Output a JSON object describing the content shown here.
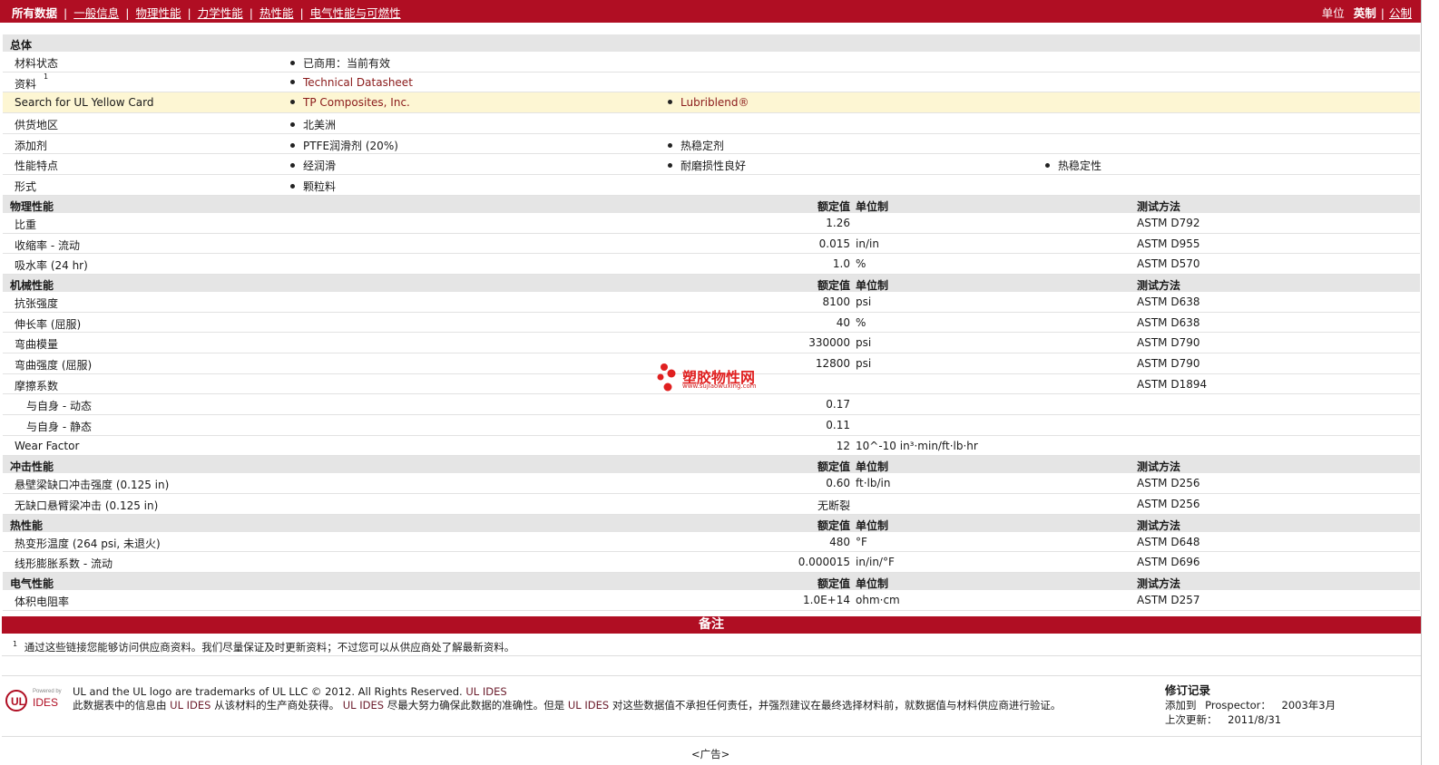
{
  "topnav": {
    "items": [
      "所有数据",
      "一般信息",
      "物理性能",
      "力学性能",
      "热性能",
      "电气性能与可燃性"
    ],
    "sep": "|",
    "units_label": "单位",
    "units_selected": "英制",
    "units_other": "公制"
  },
  "general": {
    "title": "总体",
    "rows": [
      {
        "label": "材料状态",
        "values": [
          "已商用：当前有效"
        ]
      },
      {
        "label": "资料",
        "sup": "1",
        "values": [
          "Technical Datasheet"
        ]
      },
      {
        "label": "Search for UL Yellow Card",
        "values": [
          "TP Composites, Inc.",
          "Lubriblend®"
        ]
      },
      {
        "label": "供货地区",
        "values": [
          "北美洲"
        ]
      },
      {
        "label": "添加剂",
        "values": [
          "PTFE润滑剂 (20%)",
          "热稳定剂"
        ]
      },
      {
        "label": "性能特点",
        "values": [
          "经润滑",
          "耐磨损性良好",
          "热稳定性"
        ]
      },
      {
        "label": "形式",
        "values": [
          "颗粒料"
        ]
      }
    ]
  },
  "headers": {
    "value": "额定值",
    "unit": "单位制",
    "method": "测试方法"
  },
  "sections": [
    {
      "title": "物理性能",
      "rows": [
        {
          "label": "比重",
          "value": "1.26",
          "unit": "",
          "method": "ASTM D792"
        },
        {
          "label": "收缩率  - 流动",
          "value": "0.015",
          "unit": "in/in",
          "method": "ASTM D955"
        },
        {
          "label": "吸水率 (24 hr)",
          "value": "1.0",
          "unit": "%",
          "method": "ASTM D570"
        }
      ]
    },
    {
      "title": "机械性能",
      "rows": [
        {
          "label": "抗张强度",
          "value": "8100",
          "unit": "psi",
          "method": "ASTM D638"
        },
        {
          "label": "伸长率 (屈服)",
          "value": "40",
          "unit": "%",
          "method": "ASTM D638"
        },
        {
          "label": "弯曲模量",
          "value": "330000",
          "unit": "psi",
          "method": "ASTM D790"
        },
        {
          "label": "弯曲强度 (屈服)",
          "value": "12800",
          "unit": "psi",
          "method": "ASTM D790"
        },
        {
          "label": "摩擦系数",
          "value": "",
          "unit": "",
          "method": "ASTM D1894"
        },
        {
          "label": "与自身  - 动态",
          "indent": true,
          "value": "0.17",
          "unit": "",
          "method": ""
        },
        {
          "label": "与自身  - 静态",
          "indent": true,
          "value": "0.11",
          "unit": "",
          "method": ""
        },
        {
          "label": "Wear Factor",
          "value": "12",
          "unit": "10^-10 in³·min/ft·lb·hr",
          "method": ""
        }
      ]
    },
    {
      "title": "冲击性能",
      "rows": [
        {
          "label": "悬壁梁缺口冲击强度 (0.125 in)",
          "value": "0.60",
          "unit": "ft·lb/in",
          "method": "ASTM D256"
        },
        {
          "label": "无缺口悬臂梁冲击 (0.125 in)",
          "value": "无断裂",
          "unit": "",
          "method": "ASTM D256"
        }
      ]
    },
    {
      "title": "热性能",
      "rows": [
        {
          "label": "热变形温度 (264 psi, 未退火)",
          "value": "480",
          "unit": "°F",
          "method": "ASTM D648"
        },
        {
          "label": "线形膨胀系数  - 流动",
          "value": "0.000015",
          "unit": "in/in/°F",
          "method": "ASTM D696"
        }
      ]
    },
    {
      "title": "电气性能",
      "rows": [
        {
          "label": "体积电阻率",
          "value": "1.0E+14",
          "unit": "ohm·cm",
          "method": "ASTM D257"
        }
      ]
    }
  ],
  "notes": {
    "title": "备注",
    "footnote_num": "1",
    "footnote_text": "通过这些链接您能够访问供应商资料。我们尽量保证及时更新资料；不过您可以从供应商处了解最新资料。"
  },
  "footer": {
    "logo_small": "Powered by",
    "logo_ul": "UL",
    "logo_ides": "IDES",
    "legal_line1_a": "UL and the UL logo are trademarks of UL LLC © 2012. All Rights Reserved.",
    "legal_line1_b": "UL IDES",
    "legal_line2_a": "此数据表中的信息由",
    "legal_ul1": "UL IDES",
    "legal_line2_b": "从该材料的生产商处获得。",
    "legal_ul2": "UL IDES",
    "legal_line2_c": "尽最大努力确保此数据的准确性。但是",
    "legal_ul3": "UL IDES",
    "legal_line2_d": "对这些数据值不承担任何责任，并强烈建议在最终选择材料前，就数据值与材料供应商进行验证。",
    "rev_title": "修订记录",
    "rev_added_label": "添加到",
    "rev_added_where": "Prospector：",
    "rev_added_date": "2003年3月",
    "rev_updated_label": "上次更新：",
    "rev_updated_date": "2011/8/31",
    "ad": "<广告>"
  },
  "watermark": {
    "text": "塑胶物性网",
    "url": "www.sujiaowuxing.com",
    "color": "#e02020"
  }
}
